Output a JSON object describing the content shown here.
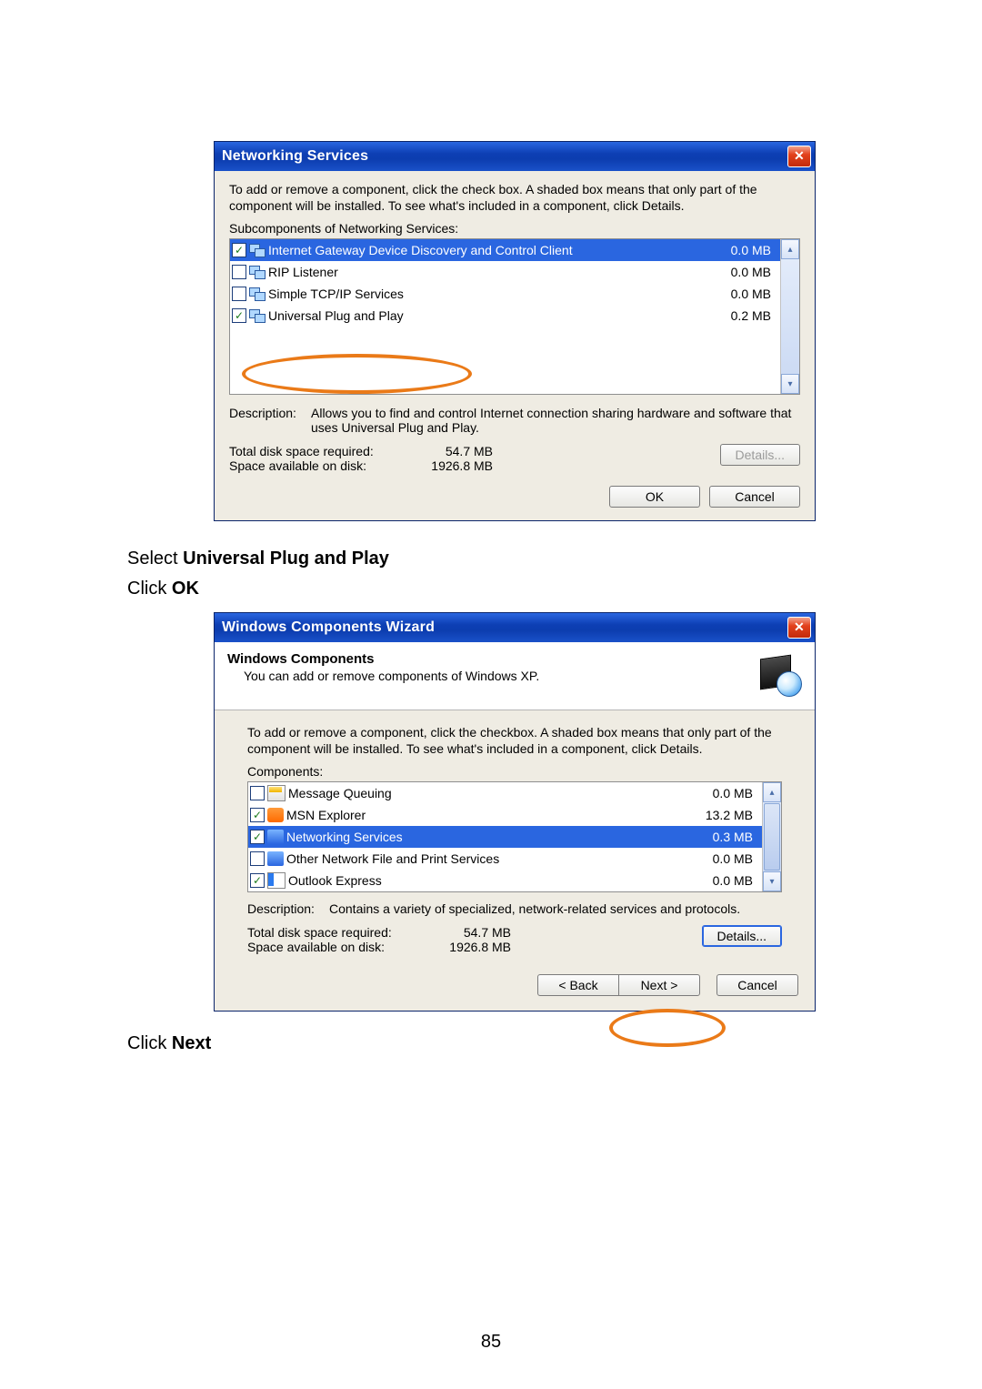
{
  "page_number": "85",
  "caption1_prefix": "Select ",
  "caption1_bold": "Universal Plug and Play",
  "caption2_prefix": "Click ",
  "caption2_bold": "OK",
  "caption3_prefix": "Click ",
  "caption3_bold": "Next",
  "dialog1": {
    "title": "Networking Services",
    "instructions": "To add or remove a component, click the check box. A shaded box means that only part of the component will be installed. To see what's included in a component, click Details.",
    "list_label": "Subcomponents of Networking Services:",
    "items": [
      {
        "checked": true,
        "label": "Internet Gateway Device Discovery and Control Client",
        "size": "0.0 MB",
        "selected": true
      },
      {
        "checked": false,
        "label": "RIP Listener",
        "size": "0.0 MB",
        "selected": false
      },
      {
        "checked": false,
        "label": "Simple TCP/IP Services",
        "size": "0.0 MB",
        "selected": false
      },
      {
        "checked": true,
        "label": "Universal Plug and Play",
        "size": "0.2 MB",
        "selected": false
      }
    ],
    "desc_label": "Description:",
    "desc_text": "Allows you to find and control Internet connection sharing hardware and software that uses Universal Plug and Play.",
    "total_label": "Total disk space required:",
    "total_value": "54.7 MB",
    "avail_label": "Space available on disk:",
    "avail_value": "1926.8 MB",
    "details_btn": "Details...",
    "ok_btn": "OK",
    "cancel_btn": "Cancel"
  },
  "dialog2": {
    "title": "Windows Components Wizard",
    "header_h1": "Windows Components",
    "header_h2": "You can add or remove components of Windows XP.",
    "instructions": "To add or remove a component, click the checkbox.  A shaded box means that only part of the component will be installed.  To see what's included in a component, click Details.",
    "list_label": "Components:",
    "items": [
      {
        "checked": false,
        "label": "Message Queuing",
        "size": "0.0 MB",
        "icon": "env",
        "selected": false
      },
      {
        "checked": true,
        "label": "MSN Explorer",
        "size": "13.2 MB",
        "icon": "msn",
        "selected": false
      },
      {
        "checked": true,
        "label": "Networking Services",
        "size": "0.3 MB",
        "icon": "blue",
        "selected": true
      },
      {
        "checked": false,
        "label": "Other Network File and Print Services",
        "size": "0.0 MB",
        "icon": "blue",
        "selected": false
      },
      {
        "checked": true,
        "label": "Outlook Express",
        "size": "0.0 MB",
        "icon": "oe",
        "selected": false
      }
    ],
    "desc_label": "Description:",
    "desc_text": "Contains a variety of specialized, network-related services and protocols.",
    "total_label": "Total disk space required:",
    "total_value": "54.7 MB",
    "avail_label": "Space available on disk:",
    "avail_value": "1926.8 MB",
    "details_btn": "Details...",
    "back_btn": "< Back",
    "next_btn": "Next >",
    "cancel_btn": "Cancel"
  }
}
